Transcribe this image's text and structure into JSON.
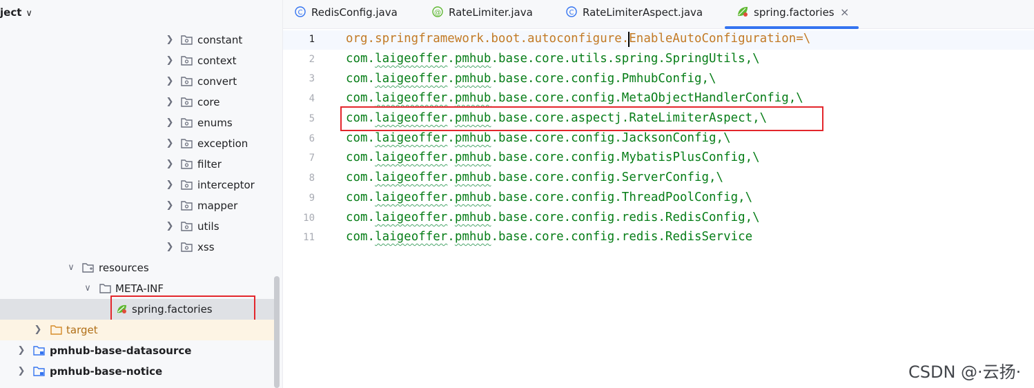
{
  "project": {
    "title": "ject"
  },
  "tree": {
    "folders": [
      "constant",
      "context",
      "convert",
      "core",
      "enums",
      "exception",
      "filter",
      "interceptor",
      "mapper",
      "utils",
      "xss"
    ],
    "resources": "resources",
    "meta_inf": "META-INF",
    "spring_factories": "spring.factories",
    "target": "target",
    "modules": [
      "pmhub-base-datasource",
      "pmhub-base-notice"
    ]
  },
  "tabs": [
    {
      "label": "RedisConfig.java",
      "icon": "class-icon"
    },
    {
      "label": "RateLimiter.java",
      "icon": "annotation-icon"
    },
    {
      "label": "RateLimiterAspect.java",
      "icon": "class-icon"
    },
    {
      "label": "spring.factories",
      "icon": "spring-icon",
      "active": true,
      "close": "×"
    }
  ],
  "editor": {
    "line_numbers": [
      "1",
      "2",
      "3",
      "4",
      "5",
      "6",
      "7",
      "8",
      "9",
      "10",
      "11"
    ],
    "lines": [
      {
        "pre": "org.springframework.boot.autoconfigure.EnableAutoConfiguration=\\"
      },
      {
        "pre": "com.",
        "sq1": "laigeoffer",
        "mid": ".",
        "sq2": "pmhub",
        "post": ".base.core.utils.spring.SpringUtils,\\"
      },
      {
        "pre": "com.",
        "sq1": "laigeoffer",
        "mid": ".",
        "sq2": "pmhub",
        "post": ".base.core.config.PmhubConfig,\\"
      },
      {
        "pre": "com.",
        "sq1": "laigeoffer",
        "mid": ".",
        "sq2": "pmhub",
        "post": ".base.core.config.MetaObjectHandlerConfig,\\"
      },
      {
        "pre": "com.",
        "sq1": "laigeoffer",
        "mid": ".",
        "sq2": "pmhub",
        "post": ".base.core.aspectj.RateLimiterAspect,\\"
      },
      {
        "pre": "com.",
        "sq1": "laigeoffer",
        "mid": ".",
        "sq2": "pmhub",
        "post": ".base.core.config.JacksonConfig,\\"
      },
      {
        "pre": "com.",
        "sq1": "laigeoffer",
        "mid": ".",
        "sq2": "pmhub",
        "post": ".base.core.config.MybatisPlusConfig,\\"
      },
      {
        "pre": "com.",
        "sq1": "laigeoffer",
        "mid": ".",
        "sq2": "pmhub",
        "post": ".base.core.config.ServerConfig,\\"
      },
      {
        "pre": "com.",
        "sq1": "laigeoffer",
        "mid": ".",
        "sq2": "pmhub",
        "post": ".base.core.config.ThreadPoolConfig,\\"
      },
      {
        "pre": "com.",
        "sq1": "laigeoffer",
        "mid": ".",
        "sq2": "pmhub",
        "post": ".base.core.config.redis.RedisConfig,\\"
      },
      {
        "pre": "com.",
        "sq1": "laigeoffer",
        "mid": ".",
        "sq2": "pmhub",
        "post": ".base.core.config.redis.RedisService"
      }
    ]
  },
  "watermark": "CSDN @·云扬·",
  "colors": {
    "accent": "#3574f0",
    "highlight_box": "#e3262b",
    "string": "#067d17",
    "key": "#c27a25"
  }
}
